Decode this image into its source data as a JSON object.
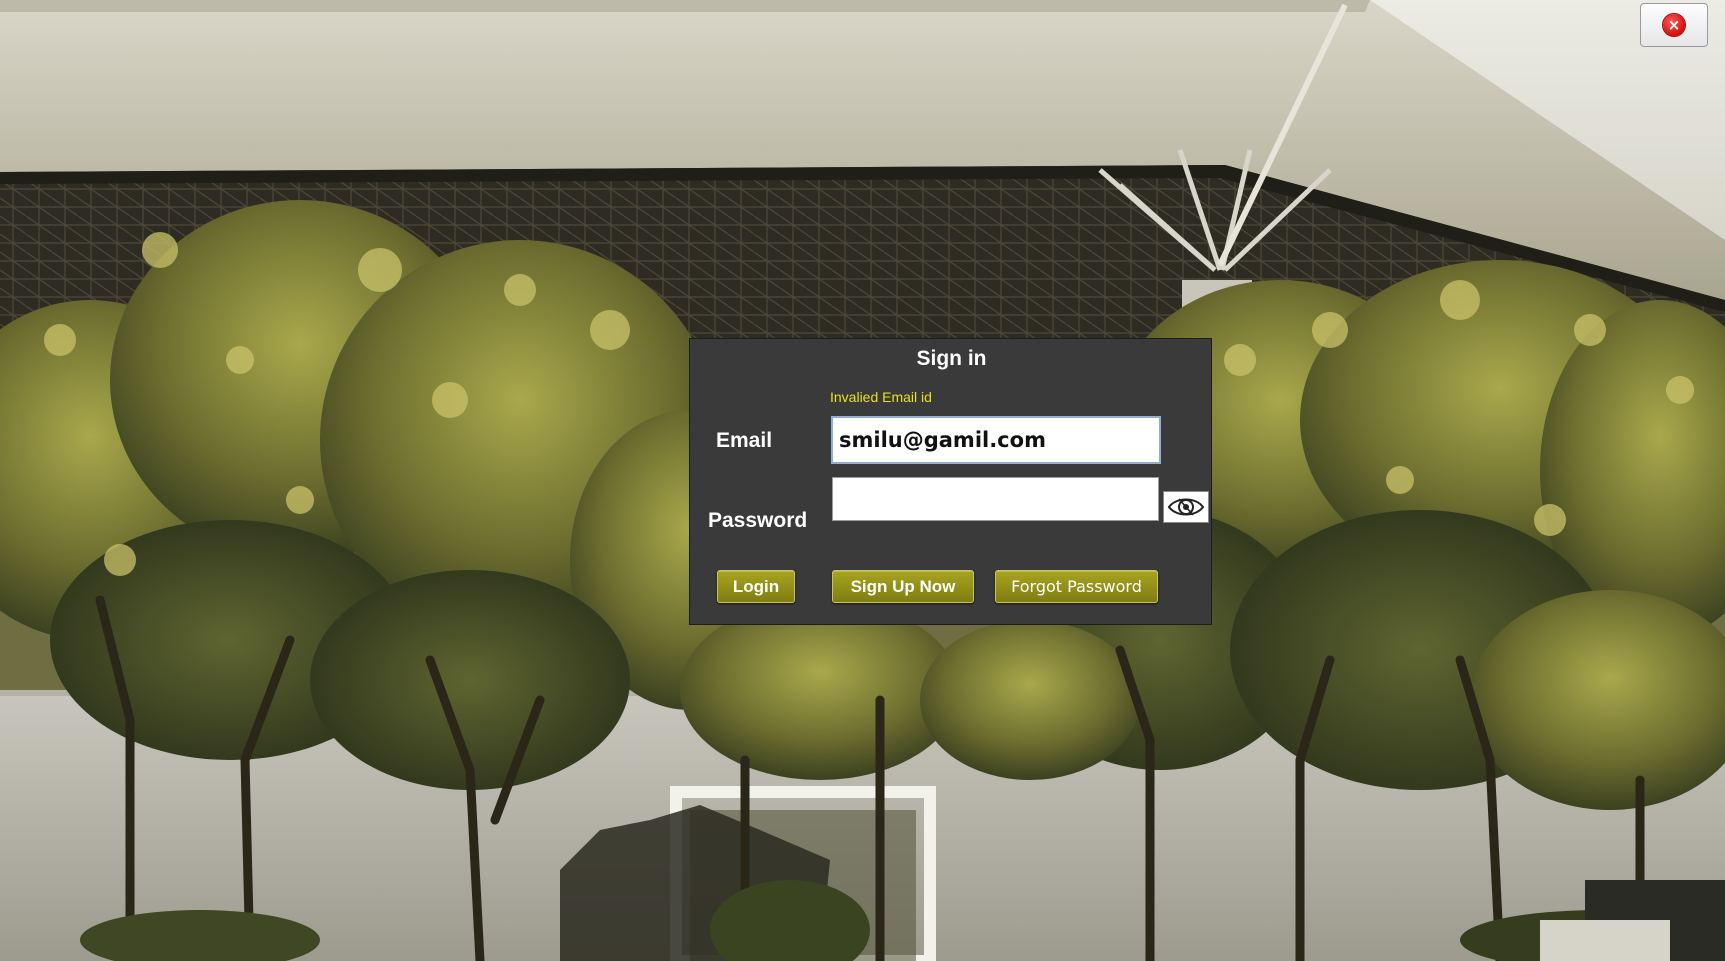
{
  "window": {
    "close_icon": "close-icon",
    "close_color": "#e01515"
  },
  "signin": {
    "title": "Sign in",
    "error_message": "Invalied Email id",
    "error_color": "#e8e020",
    "email_label": "Email",
    "email_value": "smilu@gamil.com",
    "password_label": "Password",
    "password_value": "",
    "toggle_icon": "eye-icon",
    "login_label": "Login",
    "signup_label": "Sign Up Now",
    "forgot_label": "Forgot Password",
    "accent_color": "#8f8c18",
    "panel_color": "#3a3a3a"
  }
}
